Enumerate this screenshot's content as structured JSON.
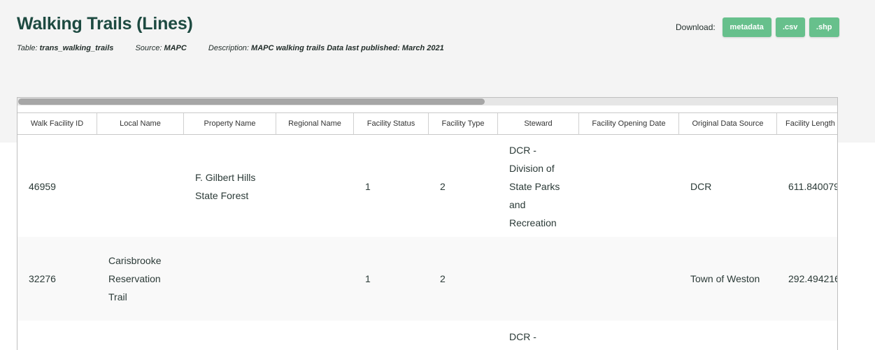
{
  "page": {
    "title": "Walking Trails (Lines)",
    "meta": {
      "table_label": "Table:",
      "table_value": "trans_walking_trails",
      "source_label": "Source:",
      "source_value": "MAPC",
      "description_label": "Description:",
      "description_value": "MAPC walking trails Data last published: March 2021"
    },
    "download": {
      "label": "Download:",
      "metadata": "metadata",
      "csv": ".csv",
      "shp": ".shp"
    }
  },
  "table": {
    "columns": [
      "Walk Facility ID",
      "Local Name",
      "Property Name",
      "Regional Name",
      "Facility Status",
      "Facility Type",
      "Steward",
      "Facility Opening Date",
      "Original Data Source",
      "Facility Length"
    ],
    "rows": [
      {
        "walk_facility_id": "46959",
        "local_name": "",
        "property_name": "F. Gilbert Hills State Forest",
        "regional_name": "",
        "facility_status": "1",
        "facility_type": "2",
        "steward": "DCR - Division of State Parks and Recreation",
        "facility_opening_date": "",
        "original_data_source": "DCR",
        "facility_length": "611.840079"
      },
      {
        "walk_facility_id": "32276",
        "local_name": "Carisbrooke Reservation Trail",
        "property_name": "",
        "regional_name": "",
        "facility_status": "1",
        "facility_type": "2",
        "steward": "",
        "facility_opening_date": "",
        "original_data_source": "Town of Weston",
        "facility_length": "292.494216"
      },
      {
        "walk_facility_id": "",
        "local_name": "",
        "property_name": "",
        "regional_name": "",
        "facility_status": "",
        "facility_type": "",
        "steward": "DCR -",
        "facility_opening_date": "",
        "original_data_source": "",
        "facility_length": ""
      }
    ]
  },
  "colors": {
    "accent": "#67c08c",
    "title": "#1d4a41",
    "header_band": "#f4f4f4"
  }
}
